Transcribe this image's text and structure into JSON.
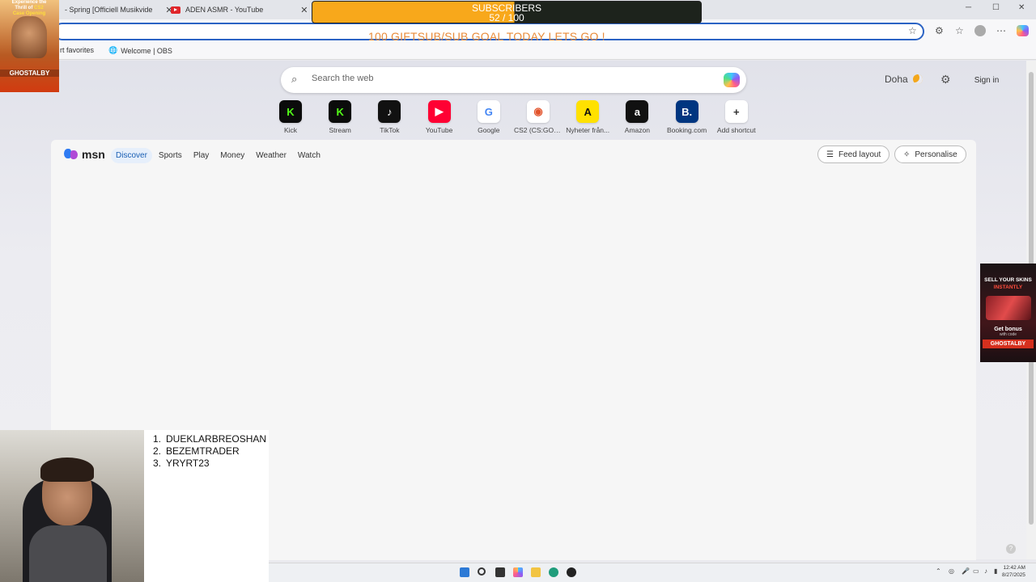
{
  "tabs": [
    {
      "label": "- Spring [Officiell Musikvide"
    },
    {
      "label": "ADEN ASMR - YouTube"
    }
  ],
  "addressbar": {
    "url": ""
  },
  "favorites": [
    {
      "label": "rt favorites"
    },
    {
      "label": "Welcome | OBS"
    }
  ],
  "search": {
    "placeholder": "Search the web"
  },
  "weather": {
    "city": "Doha"
  },
  "signin": {
    "label": "Sign in"
  },
  "shortcuts": [
    {
      "label": "Kick",
      "glyph": "K",
      "color": "#53fc18",
      "bg": "#0b0b0b"
    },
    {
      "label": "Stream",
      "glyph": "K",
      "color": "#53fc18",
      "bg": "#0b0b0b"
    },
    {
      "label": "TikTok",
      "glyph": "♪",
      "color": "#ffffff",
      "bg": "#111111"
    },
    {
      "label": "YouTube",
      "glyph": "▶",
      "color": "#ffffff",
      "bg": "#ff0033"
    },
    {
      "label": "Google",
      "glyph": "G",
      "color": "#4285f4",
      "bg": "#ffffff"
    },
    {
      "label": "CS2 (CS:GO) ...",
      "glyph": "◉",
      "color": "#e2532b",
      "bg": "#ffffff"
    },
    {
      "label": "Nyheter från...",
      "glyph": "A",
      "color": "#111111",
      "bg": "#ffe100"
    },
    {
      "label": "Amazon",
      "glyph": "a",
      "color": "#ffffff",
      "bg": "#111111"
    },
    {
      "label": "Booking.com",
      "glyph": "B.",
      "color": "#ffffff",
      "bg": "#003580"
    },
    {
      "label": "Add shortcut",
      "glyph": "+",
      "color": "#333333",
      "bg": "#ffffff"
    }
  ],
  "feed": {
    "logo": "msn",
    "nav": [
      "Discover",
      "Sports",
      "Play",
      "Money",
      "Weather",
      "Watch"
    ],
    "feed_layout": "Feed layout",
    "personalise": "Personalise"
  },
  "overlay": {
    "subs_title": "SUBSCRIBERS",
    "subs_count": "52 / 100",
    "subs_progress": 0.52,
    "goal_text": "100 GIFTSUB/SUB GOAL TODAY LETS GO !",
    "promo_left_line1": "Experience the",
    "promo_left_line2": "Thrill of",
    "promo_left_cs2": "CS2",
    "promo_left_line3": "Case Opening",
    "promo_left_name": "GHOSTALBY",
    "promo_right_line1": "SELL YOUR SKINS",
    "promo_right_line2": "INSTANTLY",
    "promo_right_bonus": "Get bonus",
    "promo_right_with": "with code",
    "promo_right_code": "GHOSTALBY",
    "top_list": [
      "DUEKLARBREOSHAN",
      "BEZEMTRADER",
      "YRYRT23"
    ]
  },
  "clock": {
    "time": "12:42 AM",
    "date": "8/27/2025"
  }
}
